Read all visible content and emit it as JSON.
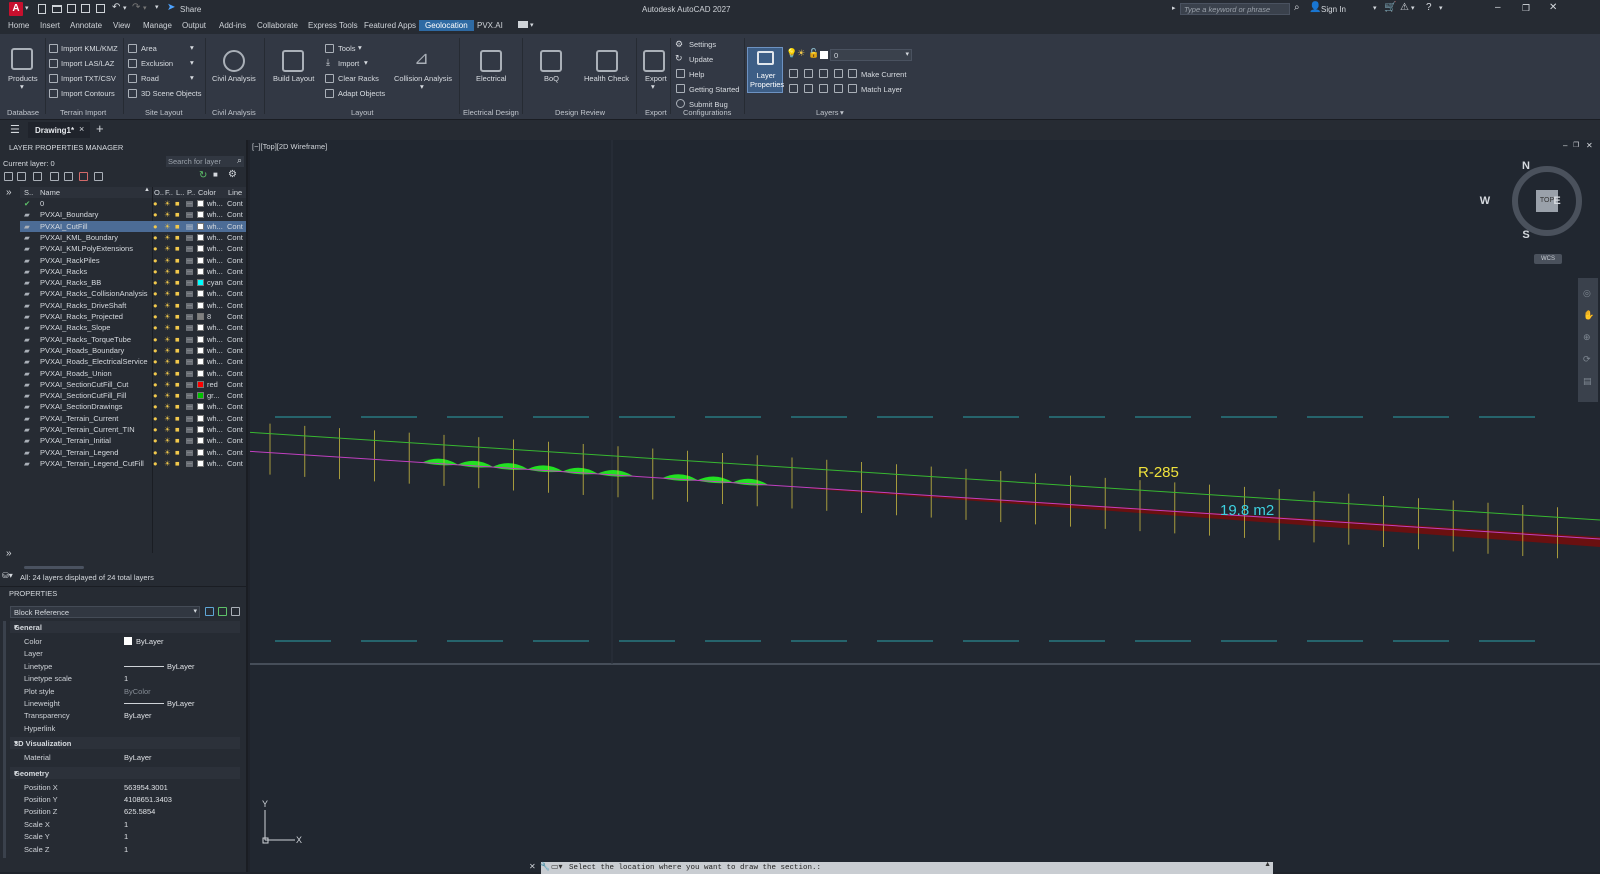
{
  "app": {
    "title": "Autodesk AutoCAD 2027",
    "logo_letter": "A",
    "share_label": "Share",
    "search_placeholder": "Type a keyword or phrase",
    "sign_in": "Sign In"
  },
  "menu": [
    "Home",
    "Insert",
    "Annotate",
    "View",
    "Manage",
    "Output",
    "Add-ins",
    "Collaborate",
    "Express Tools",
    "Featured Apps",
    "Geolocation",
    "PVX.AI"
  ],
  "menu_active": "Geolocation",
  "ribbon": {
    "products": "Products",
    "database_group": "Database",
    "terrain": [
      "Import KML/KMZ",
      "Import LAS/LAZ",
      "Import TXT/CSV",
      "Import Contours"
    ],
    "terrain_group": "Terrain Import",
    "site": [
      "Area",
      "Exclusion",
      "Road",
      "3D Scene Objects"
    ],
    "site_group": "Site Layout",
    "civil": "Civil Analysis",
    "civil_group": "Civil Analysis",
    "build_layout": "Build Layout",
    "layout_small": [
      "Tools",
      "Import",
      "Clear Racks",
      "Adapt Objects"
    ],
    "collision": "Collision Analysis",
    "layout_group": "Layout",
    "electrical": "Electrical",
    "electrical_group": "Electrical Design",
    "boq": "BoQ",
    "health": "Health Check",
    "review_group": "Design Review",
    "export": "Export",
    "export_group": "Export",
    "config": [
      "Settings",
      "Update",
      "Help",
      "Getting Started",
      "Submit Bug"
    ],
    "config_group": "Configurations",
    "layer_props": "Layer Properties",
    "layer_current_value": "0",
    "make_current": "Make Current",
    "match_layer": "Match Layer",
    "layers_group": "Layers"
  },
  "doc_tab": "Drawing1*",
  "layer_manager": {
    "title": "LAYER PROPERTIES MANAGER",
    "current": "Current layer: 0",
    "search_placeholder": "Search for layer",
    "headers": [
      "S..",
      "Name",
      "O..",
      "F..",
      "L..",
      "P..",
      "Color",
      "Line"
    ],
    "status": "All: 24 layers displayed of 24 total layers",
    "layers": [
      {
        "name": "0",
        "color": "wh...",
        "swatch": "#ffffff",
        "line": "Cont",
        "current": true
      },
      {
        "name": "PVXAI_Boundary",
        "color": "wh...",
        "swatch": "#ffffff",
        "line": "Cont"
      },
      {
        "name": "PVXAI_CutFill",
        "color": "wh...",
        "swatch": "#ffffff",
        "line": "Cont",
        "selected": true
      },
      {
        "name": "PVXAI_KML_Boundary",
        "color": "wh...",
        "swatch": "#ffffff",
        "line": "Cont"
      },
      {
        "name": "PVXAI_KMLPolyExtensions",
        "color": "wh...",
        "swatch": "#ffffff",
        "line": "Cont"
      },
      {
        "name": "PVXAI_RackPiles",
        "color": "wh...",
        "swatch": "#ffffff",
        "line": "Cont"
      },
      {
        "name": "PVXAI_Racks",
        "color": "wh...",
        "swatch": "#ffffff",
        "line": "Cont"
      },
      {
        "name": "PVXAI_Racks_BB",
        "color": "cyan",
        "swatch": "#00ffff",
        "line": "Cont"
      },
      {
        "name": "PVXAI_Racks_CollisionAnalysis",
        "color": "wh...",
        "swatch": "#ffffff",
        "line": "Cont"
      },
      {
        "name": "PVXAI_Racks_DriveShaft",
        "color": "wh...",
        "swatch": "#ffffff",
        "line": "Cont"
      },
      {
        "name": "PVXAI_Racks_Projected",
        "color": "8",
        "swatch": "#808080",
        "line": "Cont"
      },
      {
        "name": "PVXAI_Racks_Slope",
        "color": "wh...",
        "swatch": "#ffffff",
        "line": "Cont"
      },
      {
        "name": "PVXAI_Racks_TorqueTube",
        "color": "wh...",
        "swatch": "#ffffff",
        "line": "Cont"
      },
      {
        "name": "PVXAI_Roads_Boundary",
        "color": "wh...",
        "swatch": "#ffffff",
        "line": "Cont"
      },
      {
        "name": "PVXAI_Roads_ElectricalService",
        "color": "wh...",
        "swatch": "#ffffff",
        "line": "Cont"
      },
      {
        "name": "PVXAI_Roads_Union",
        "color": "wh...",
        "swatch": "#ffffff",
        "line": "Cont"
      },
      {
        "name": "PVXAI_SectionCutFill_Cut",
        "color": "red",
        "swatch": "#ff0000",
        "line": "Cont"
      },
      {
        "name": "PVXAI_SectionCutFill_Fill",
        "color": "gr...",
        "swatch": "#00c000",
        "line": "Cont"
      },
      {
        "name": "PVXAI_SectionDrawings",
        "color": "wh...",
        "swatch": "#ffffff",
        "line": "Cont"
      },
      {
        "name": "PVXAI_Terrain_Current",
        "color": "wh...",
        "swatch": "#ffffff",
        "line": "Cont"
      },
      {
        "name": "PVXAI_Terrain_Current_TIN",
        "color": "wh...",
        "swatch": "#ffffff",
        "line": "Cont"
      },
      {
        "name": "PVXAI_Terrain_Initial",
        "color": "wh...",
        "swatch": "#ffffff",
        "line": "Cont"
      },
      {
        "name": "PVXAI_Terrain_Legend",
        "color": "wh...",
        "swatch": "#ffffff",
        "line": "Cont"
      },
      {
        "name": "PVXAI_Terrain_Legend_CutFill",
        "color": "wh...",
        "swatch": "#ffffff",
        "line": "Cont"
      }
    ]
  },
  "properties": {
    "title": "PROPERTIES",
    "object_type": "Block Reference",
    "sections": [
      {
        "name": "General",
        "rows": [
          {
            "k": "Color",
            "v": "ByLayer",
            "swatch": true
          },
          {
            "k": "Layer",
            "v": ""
          },
          {
            "k": "Linetype",
            "v": "ByLayer",
            "line": true
          },
          {
            "k": "Linetype scale",
            "v": "1"
          },
          {
            "k": "Plot style",
            "v": "ByColor",
            "dim": true
          },
          {
            "k": "Lineweight",
            "v": "ByLayer",
            "line": true
          },
          {
            "k": "Transparency",
            "v": "ByLayer"
          },
          {
            "k": "Hyperlink",
            "v": ""
          }
        ]
      },
      {
        "name": "3D Visualization",
        "rows": [
          {
            "k": "Material",
            "v": "ByLayer"
          }
        ]
      },
      {
        "name": "Geometry",
        "rows": [
          {
            "k": "Position X",
            "v": "563954.3001"
          },
          {
            "k": "Position Y",
            "v": "4108651.3403"
          },
          {
            "k": "Position Z",
            "v": "625.5854"
          },
          {
            "k": "Scale X",
            "v": "1"
          },
          {
            "k": "Scale Y",
            "v": "1"
          },
          {
            "k": "Scale Z",
            "v": "1"
          }
        ]
      }
    ]
  },
  "viewport": {
    "label": "[−][Top][2D Wireframe]",
    "compass": {
      "n": "N",
      "s": "S",
      "e": "E",
      "w": "W",
      "top": "TOP",
      "wcs": "WCS"
    },
    "section_label": "R-285",
    "area_label": "19.8 m2",
    "command_prompt": "Select the location where you want to draw the section.:"
  }
}
